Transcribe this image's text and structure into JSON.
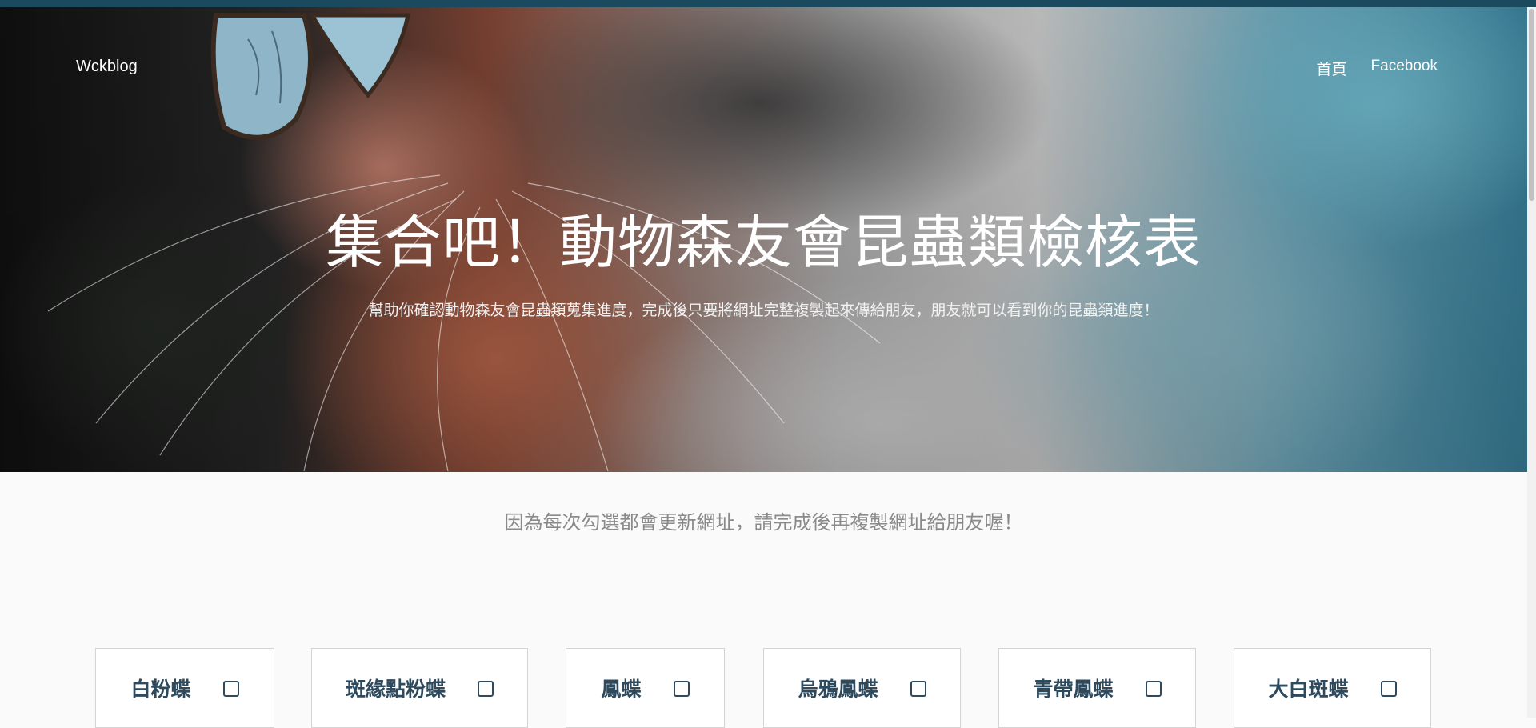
{
  "nav": {
    "brand": "Wckblog",
    "links": [
      "首頁",
      "Facebook"
    ]
  },
  "hero": {
    "title": "集合吧！動物森友會昆蟲類檢核表",
    "subtitle": "幫助你確認動物森友會昆蟲類蒐集進度，完成後只要將網址完整複製起來傳給朋友，朋友就可以看到你的昆蟲類進度！"
  },
  "notice": "因為每次勾選都會更新網址，請完成後再複製網址給朋友喔！",
  "insects": [
    {
      "name": "白粉蝶",
      "checked": false
    },
    {
      "name": "斑緣點粉蝶",
      "checked": false
    },
    {
      "name": "鳳蝶",
      "checked": false
    },
    {
      "name": "烏鴉鳳蝶",
      "checked": false
    },
    {
      "name": "青帶鳳蝶",
      "checked": false
    },
    {
      "name": "大白斑蝶",
      "checked": false
    }
  ],
  "colors": {
    "topbar": "#1b4a5f",
    "card_text": "#2e4a5e",
    "notice_text": "#8a8a8a",
    "page_bg": "#fafafa"
  }
}
